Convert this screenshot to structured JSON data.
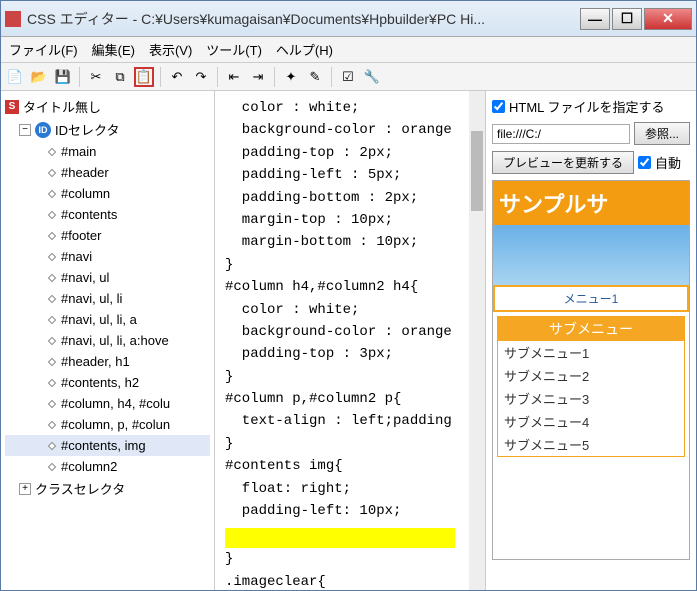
{
  "title": "CSS エディター - C:¥Users¥kumagaisan¥Documents¥Hpbuilder¥PC Hi...",
  "menu": {
    "file": "ファイル(F)",
    "edit": "編集(E)",
    "view": "表示(V)",
    "tool": "ツール(T)",
    "help": "ヘルプ(H)"
  },
  "toolbar": {
    "icons": [
      "new",
      "open",
      "save",
      "cut",
      "copy",
      "paste",
      "undo",
      "redo",
      "out",
      "in",
      "find",
      "brush",
      "check",
      "wrench"
    ]
  },
  "tree": {
    "title": "タイトル無し",
    "idselector": "IDセレクタ",
    "items": [
      "#main",
      "#header",
      "#column",
      "#contents",
      "#footer",
      "#navi",
      "#navi, ul",
      "#navi, ul, li",
      "#navi, ul, li, a",
      "#navi, ul, li, a:hove",
      "#header, h1",
      "#contents, h2",
      "#column, h4, #colu",
      "#column, p, #colun",
      "#contents, img",
      "#column2"
    ],
    "selected": 14,
    "bottom": "クラスセレクタ"
  },
  "code": "  color : white;\n  background-color : orange\n  padding-top : 2px;\n  padding-left : 5px;\n  padding-bottom : 2px;\n  margin-top : 10px;\n  margin-bottom : 10px;\n}\n#column h4,#column2 h4{\n  color : white;\n  background-color : orange\n  padding-top : 3px;\n}\n#column p,#column2 p{\n  text-align : left;padding\n}\n#contents img{\n  float: right;\n  padding-left: 10px;\n",
  "code_tail": "}\n.imageclear{",
  "preview": {
    "specify_html": "HTML ファイルを指定する",
    "url": "file:///C:/",
    "browse": "参照...",
    "refresh": "プレビューを更新する",
    "auto": "自動",
    "sample_title": "サンプルサ",
    "menu1": "メニュー1",
    "submenu_h": "サブメニュー",
    "submenus": [
      "サブメニュー1",
      "サブメニュー2",
      "サブメニュー3",
      "サブメニュー4",
      "サブメニュー5"
    ]
  }
}
